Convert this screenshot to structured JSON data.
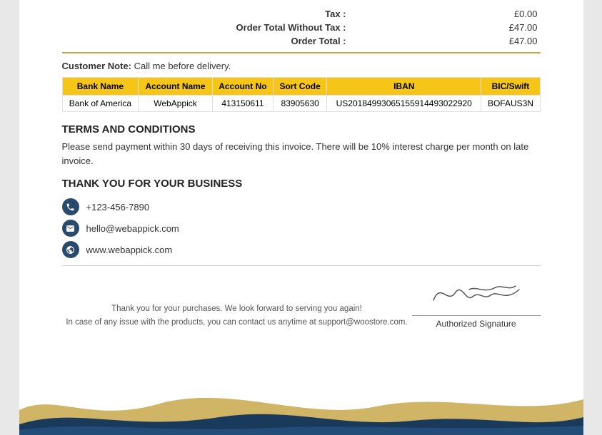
{
  "totals": {
    "tax_label": "Tax :",
    "tax_value": "£0.00",
    "order_without_tax_label": "Order Total Without Tax :",
    "order_without_tax_value": "£47.00",
    "order_total_label": "Order Total :",
    "order_total_value": "£47.00"
  },
  "customer_note": {
    "label": "Customer Note:",
    "text": "Call me before delivery."
  },
  "bank_table": {
    "headers": [
      "Bank Name",
      "Account Name",
      "Account No",
      "Sort Code",
      "IBAN",
      "BIC/Swift"
    ],
    "rows": [
      {
        "bank_name": "Bank of America",
        "account_name": "WebAppick",
        "account_no": "413150611",
        "sort_code": "83905630",
        "iban": "US201849930651559144930 22920",
        "bic_swift": "BOFAUS3N"
      }
    ]
  },
  "terms": {
    "title": "TERMS  AND CONDITIONS",
    "body": "Please send payment within 30 days of receiving this invoice. There will be 10% interest charge per month on late invoice."
  },
  "thank_you": "THANK YOU FOR YOUR BUSINESS",
  "contacts": [
    {
      "icon": "phone",
      "value": "+123-456-7890"
    },
    {
      "icon": "email",
      "value": "hello@webappick.com"
    },
    {
      "icon": "web",
      "value": "www.webappick.com"
    }
  ],
  "footer": {
    "line1": "Thank you for your purchases. We look forward to serving you again!",
    "line2": "In case of any issue with the products, you can contact us anytime at support@woostore.com.",
    "signature_label": "Authorized Signature"
  }
}
